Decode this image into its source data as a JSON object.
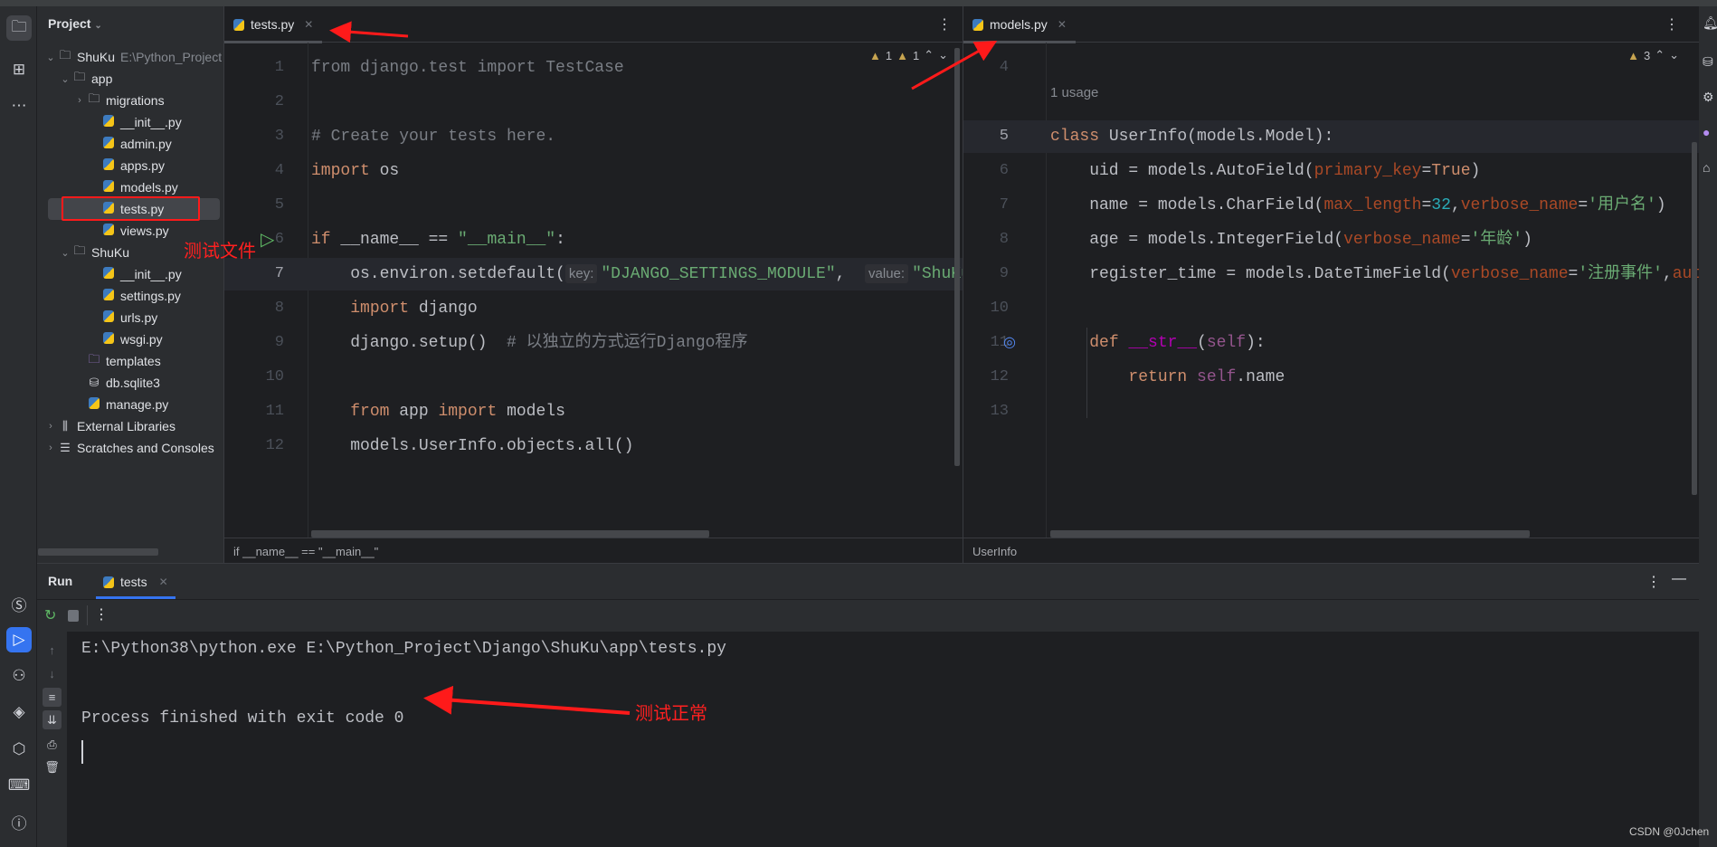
{
  "project_panel": {
    "title": "Project",
    "tree": [
      {
        "label": "ShuKu",
        "hint": "E:\\Python_Project",
        "type": "folder",
        "expanded": true,
        "level": 0
      },
      {
        "label": "app",
        "type": "module",
        "expanded": true,
        "level": 1
      },
      {
        "label": "migrations",
        "type": "module",
        "expanded": false,
        "level": 2
      },
      {
        "label": "__init__.py",
        "type": "py",
        "level": 3
      },
      {
        "label": "admin.py",
        "type": "py",
        "level": 3
      },
      {
        "label": "apps.py",
        "type": "py",
        "level": 3
      },
      {
        "label": "models.py",
        "type": "py",
        "level": 3
      },
      {
        "label": "tests.py",
        "type": "py",
        "level": 3,
        "selected": true
      },
      {
        "label": "views.py",
        "type": "py",
        "level": 3
      },
      {
        "label": "ShuKu",
        "type": "module",
        "expanded": true,
        "level": 1
      },
      {
        "label": "__init__.py",
        "type": "py",
        "level": 3
      },
      {
        "label": "settings.py",
        "type": "py",
        "level": 3
      },
      {
        "label": "urls.py",
        "type": "py",
        "level": 3
      },
      {
        "label": "wsgi.py",
        "type": "py",
        "level": 3
      },
      {
        "label": "templates",
        "type": "templates",
        "level": 2
      },
      {
        "label": "db.sqlite3",
        "type": "db",
        "level": 2
      },
      {
        "label": "manage.py",
        "type": "py",
        "level": 2
      },
      {
        "label": "External Libraries",
        "type": "lib",
        "expanded": false,
        "level": 0
      },
      {
        "label": "Scratches and Consoles",
        "type": "scratch",
        "expanded": false,
        "level": 0
      }
    ]
  },
  "editor_left": {
    "tab": "tests.py",
    "warnings": [
      "1",
      "1"
    ],
    "breadcrumb": "if __name__ == \"__main__\"",
    "lines": [
      {
        "n": "1",
        "tokens": [
          [
            "from django.test import TestCase",
            "cm"
          ]
        ]
      },
      {
        "n": "2",
        "tokens": []
      },
      {
        "n": "3",
        "tokens": [
          [
            "# Create your tests here.",
            "cm"
          ]
        ]
      },
      {
        "n": "4",
        "tokens": [
          [
            "import",
            "kw"
          ],
          [
            " os",
            "plain"
          ]
        ]
      },
      {
        "n": "5",
        "tokens": []
      },
      {
        "n": "6",
        "run": true,
        "tokens": [
          [
            "if",
            "kw"
          ],
          [
            " __name__ == ",
            "plain"
          ],
          [
            "\"__main__\"",
            "str"
          ],
          [
            ":",
            "plain"
          ]
        ]
      },
      {
        "n": "7",
        "current": true,
        "tokens": [
          [
            "    os.environ.setdefault(",
            "plain"
          ],
          [
            "key:",
            "hint"
          ],
          [
            "\"DJANGO_SETTINGS_MODULE\"",
            "str"
          ],
          [
            ",  ",
            "plain"
          ],
          [
            "value:",
            "hint"
          ],
          [
            "\"ShuKu.settings\")",
            "str"
          ]
        ]
      },
      {
        "n": "8",
        "tokens": [
          [
            "    ",
            "plain"
          ],
          [
            "import",
            "kw"
          ],
          [
            " django",
            "plain"
          ]
        ]
      },
      {
        "n": "9",
        "tokens": [
          [
            "    django.setup()  ",
            "plain"
          ],
          [
            "# 以独立的方式运行Django程序",
            "cm"
          ]
        ]
      },
      {
        "n": "10",
        "tokens": []
      },
      {
        "n": "11",
        "tokens": [
          [
            "    ",
            "plain"
          ],
          [
            "from",
            "kw"
          ],
          [
            " app ",
            "plain"
          ],
          [
            "import",
            "kw"
          ],
          [
            " models",
            "plain"
          ]
        ]
      },
      {
        "n": "12",
        "tokens": [
          [
            "    models.UserInfo.objects.all()",
            "plain"
          ]
        ]
      }
    ]
  },
  "editor_right": {
    "tab": "models.py",
    "warnings": [
      "3"
    ],
    "breadcrumb": "UserInfo",
    "usage_hint": "1 usage",
    "lines": [
      {
        "n": "4",
        "tokens": []
      },
      {
        "n": "5",
        "current": true,
        "tokens": [
          [
            "class",
            "kw"
          ],
          [
            " UserInfo(models.Model):",
            "plain"
          ]
        ]
      },
      {
        "n": "6",
        "tokens": [
          [
            "    uid = models.AutoField(",
            "plain"
          ],
          [
            "primary_key",
            "prm"
          ],
          [
            "=",
            "plain"
          ],
          [
            "True",
            "kw"
          ],
          [
            ")",
            "plain"
          ]
        ]
      },
      {
        "n": "7",
        "tokens": [
          [
            "    name = models.CharField(",
            "plain"
          ],
          [
            "max_length",
            "prm"
          ],
          [
            "=",
            "plain"
          ],
          [
            "32",
            "num"
          ],
          [
            ",",
            "plain"
          ],
          [
            "verbose_name",
            "prm"
          ],
          [
            "=",
            "plain"
          ],
          [
            "'用户名'",
            "str"
          ],
          [
            ")",
            "plain"
          ]
        ]
      },
      {
        "n": "8",
        "tokens": [
          [
            "    age = models.IntegerField(",
            "plain"
          ],
          [
            "verbose_name",
            "prm"
          ],
          [
            "=",
            "plain"
          ],
          [
            "'年龄'",
            "str"
          ],
          [
            ")",
            "plain"
          ]
        ]
      },
      {
        "n": "9",
        "tokens": [
          [
            "    register_time = models.DateTimeField(",
            "plain"
          ],
          [
            "verbose_name",
            "prm"
          ],
          [
            "=",
            "plain"
          ],
          [
            "'注册事件'",
            "str"
          ],
          [
            ",",
            "plain"
          ],
          [
            "auto_now_add",
            "prm"
          ]
        ]
      },
      {
        "n": "10",
        "tokens": []
      },
      {
        "n": "11",
        "override": true,
        "tokens": [
          [
            "    ",
            "plain"
          ],
          [
            "def",
            "kw"
          ],
          [
            " ",
            "plain"
          ],
          [
            "__str__",
            "dun"
          ],
          [
            "(",
            "plain"
          ],
          [
            "self",
            "slf"
          ],
          [
            "):",
            "plain"
          ]
        ]
      },
      {
        "n": "12",
        "tokens": [
          [
            "        ",
            "plain"
          ],
          [
            "return",
            "kw"
          ],
          [
            " ",
            "plain"
          ],
          [
            "self",
            "slf"
          ],
          [
            ".name",
            "plain"
          ]
        ]
      },
      {
        "n": "13",
        "tokens": []
      }
    ]
  },
  "run_panel": {
    "title": "Run",
    "tab": "tests",
    "console": [
      "E:\\Python38\\python.exe E:\\Python_Project\\Django\\ShuKu\\app\\tests.py",
      "",
      "Process finished with exit code 0"
    ]
  },
  "annotations": {
    "test_file": "测试文件",
    "test_ok": "测试正常",
    "color": "#ff1a1a"
  },
  "watermark": "CSDN @0Jchen",
  "colors": {
    "accent": "#3574f0",
    "editor_bg": "#1e1f22",
    "panel_bg": "#2b2d30",
    "keyword": "#cf8e6d",
    "string": "#6aab73",
    "comment": "#7a7e85"
  }
}
